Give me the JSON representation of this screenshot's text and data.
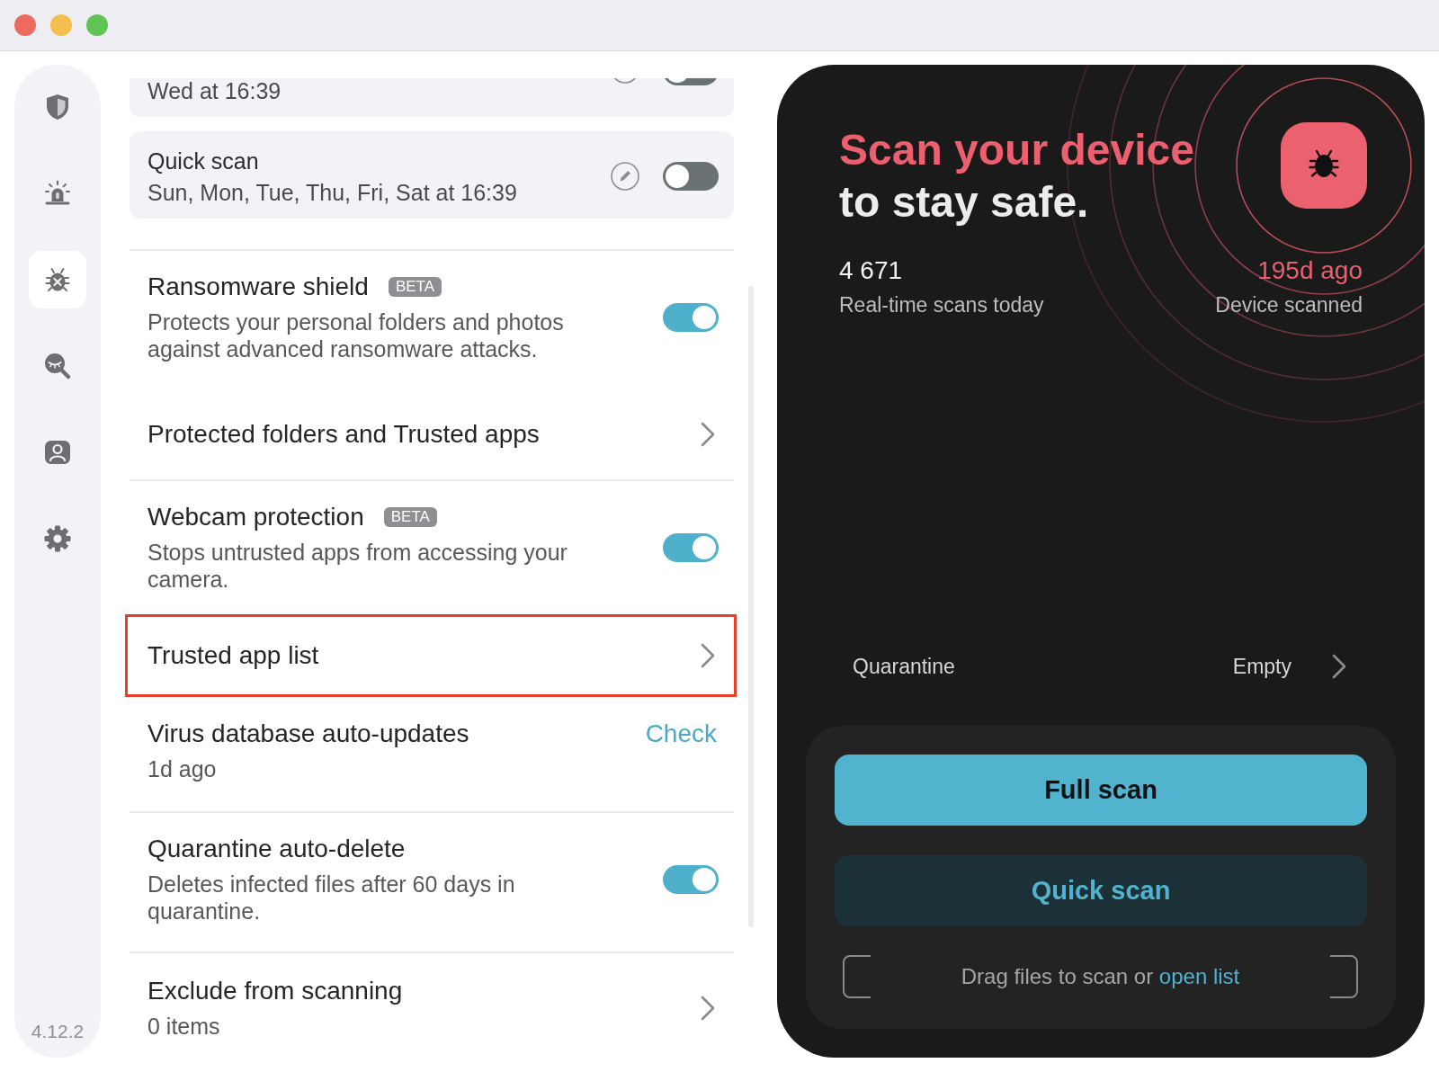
{
  "sidebar": {
    "items": [
      {
        "kind": "shield",
        "selected": false
      },
      {
        "kind": "siren",
        "selected": false
      },
      {
        "kind": "bug",
        "selected": true
      },
      {
        "kind": "eye-search",
        "selected": false
      },
      {
        "kind": "person",
        "selected": false
      },
      {
        "kind": "gear",
        "selected": false
      }
    ],
    "version": "4.12.2"
  },
  "schedules": [
    {
      "subtitle": "Wed at 16:39",
      "on": false
    },
    {
      "title": "Quick scan",
      "subtitle": "Sun, Mon, Tue, Thu, Fri, Sat at 16:39",
      "on": false
    }
  ],
  "settings_groups": [
    {
      "items": [
        {
          "kind": "toggle",
          "title": "Ransomware shield",
          "badge": "BETA",
          "description": "Protects your personal folders and photos against advanced ransomware attacks.",
          "on": true
        },
        {
          "kind": "link",
          "title": "Protected folders and Trusted apps",
          "highlighted": false
        }
      ]
    },
    {
      "items": [
        {
          "kind": "toggle",
          "title": "Webcam protection",
          "badge": "BETA",
          "description": "Stops untrusted apps from accessing your camera.",
          "on": true
        },
        {
          "kind": "link",
          "title": "Trusted app list",
          "highlighted": true
        },
        {
          "kind": "action",
          "title": "Virus database auto-updates",
          "subtitle": "1d ago",
          "action": "Check"
        }
      ]
    },
    {
      "items": [
        {
          "kind": "toggle",
          "title": "Quarantine auto-delete",
          "description": "Deletes infected files after 60 days in quarantine.",
          "on": true
        }
      ]
    },
    {
      "items": [
        {
          "kind": "link",
          "title": "Exclude from scanning",
          "subtitle": "0 items",
          "highlighted": false
        }
      ]
    }
  ],
  "scan_panel": {
    "headline": [
      {
        "text": "Scan your device",
        "accent": true
      },
      {
        "text": "to stay safe.",
        "accent": false
      }
    ],
    "stats": [
      {
        "value": "4 671",
        "label": "Real-time scans today",
        "accent": false
      },
      {
        "value": "195d ago",
        "label": "Device scanned",
        "accent": true
      }
    ],
    "quarantine": {
      "label": "Quarantine",
      "value": "Empty"
    },
    "buttons": [
      {
        "label": "Full scan",
        "kind": "primary"
      },
      {
        "label": "Quick scan",
        "kind": "secondary"
      }
    ],
    "drop_area": {
      "text": "Drag files to scan or",
      "link": "open list"
    }
  }
}
